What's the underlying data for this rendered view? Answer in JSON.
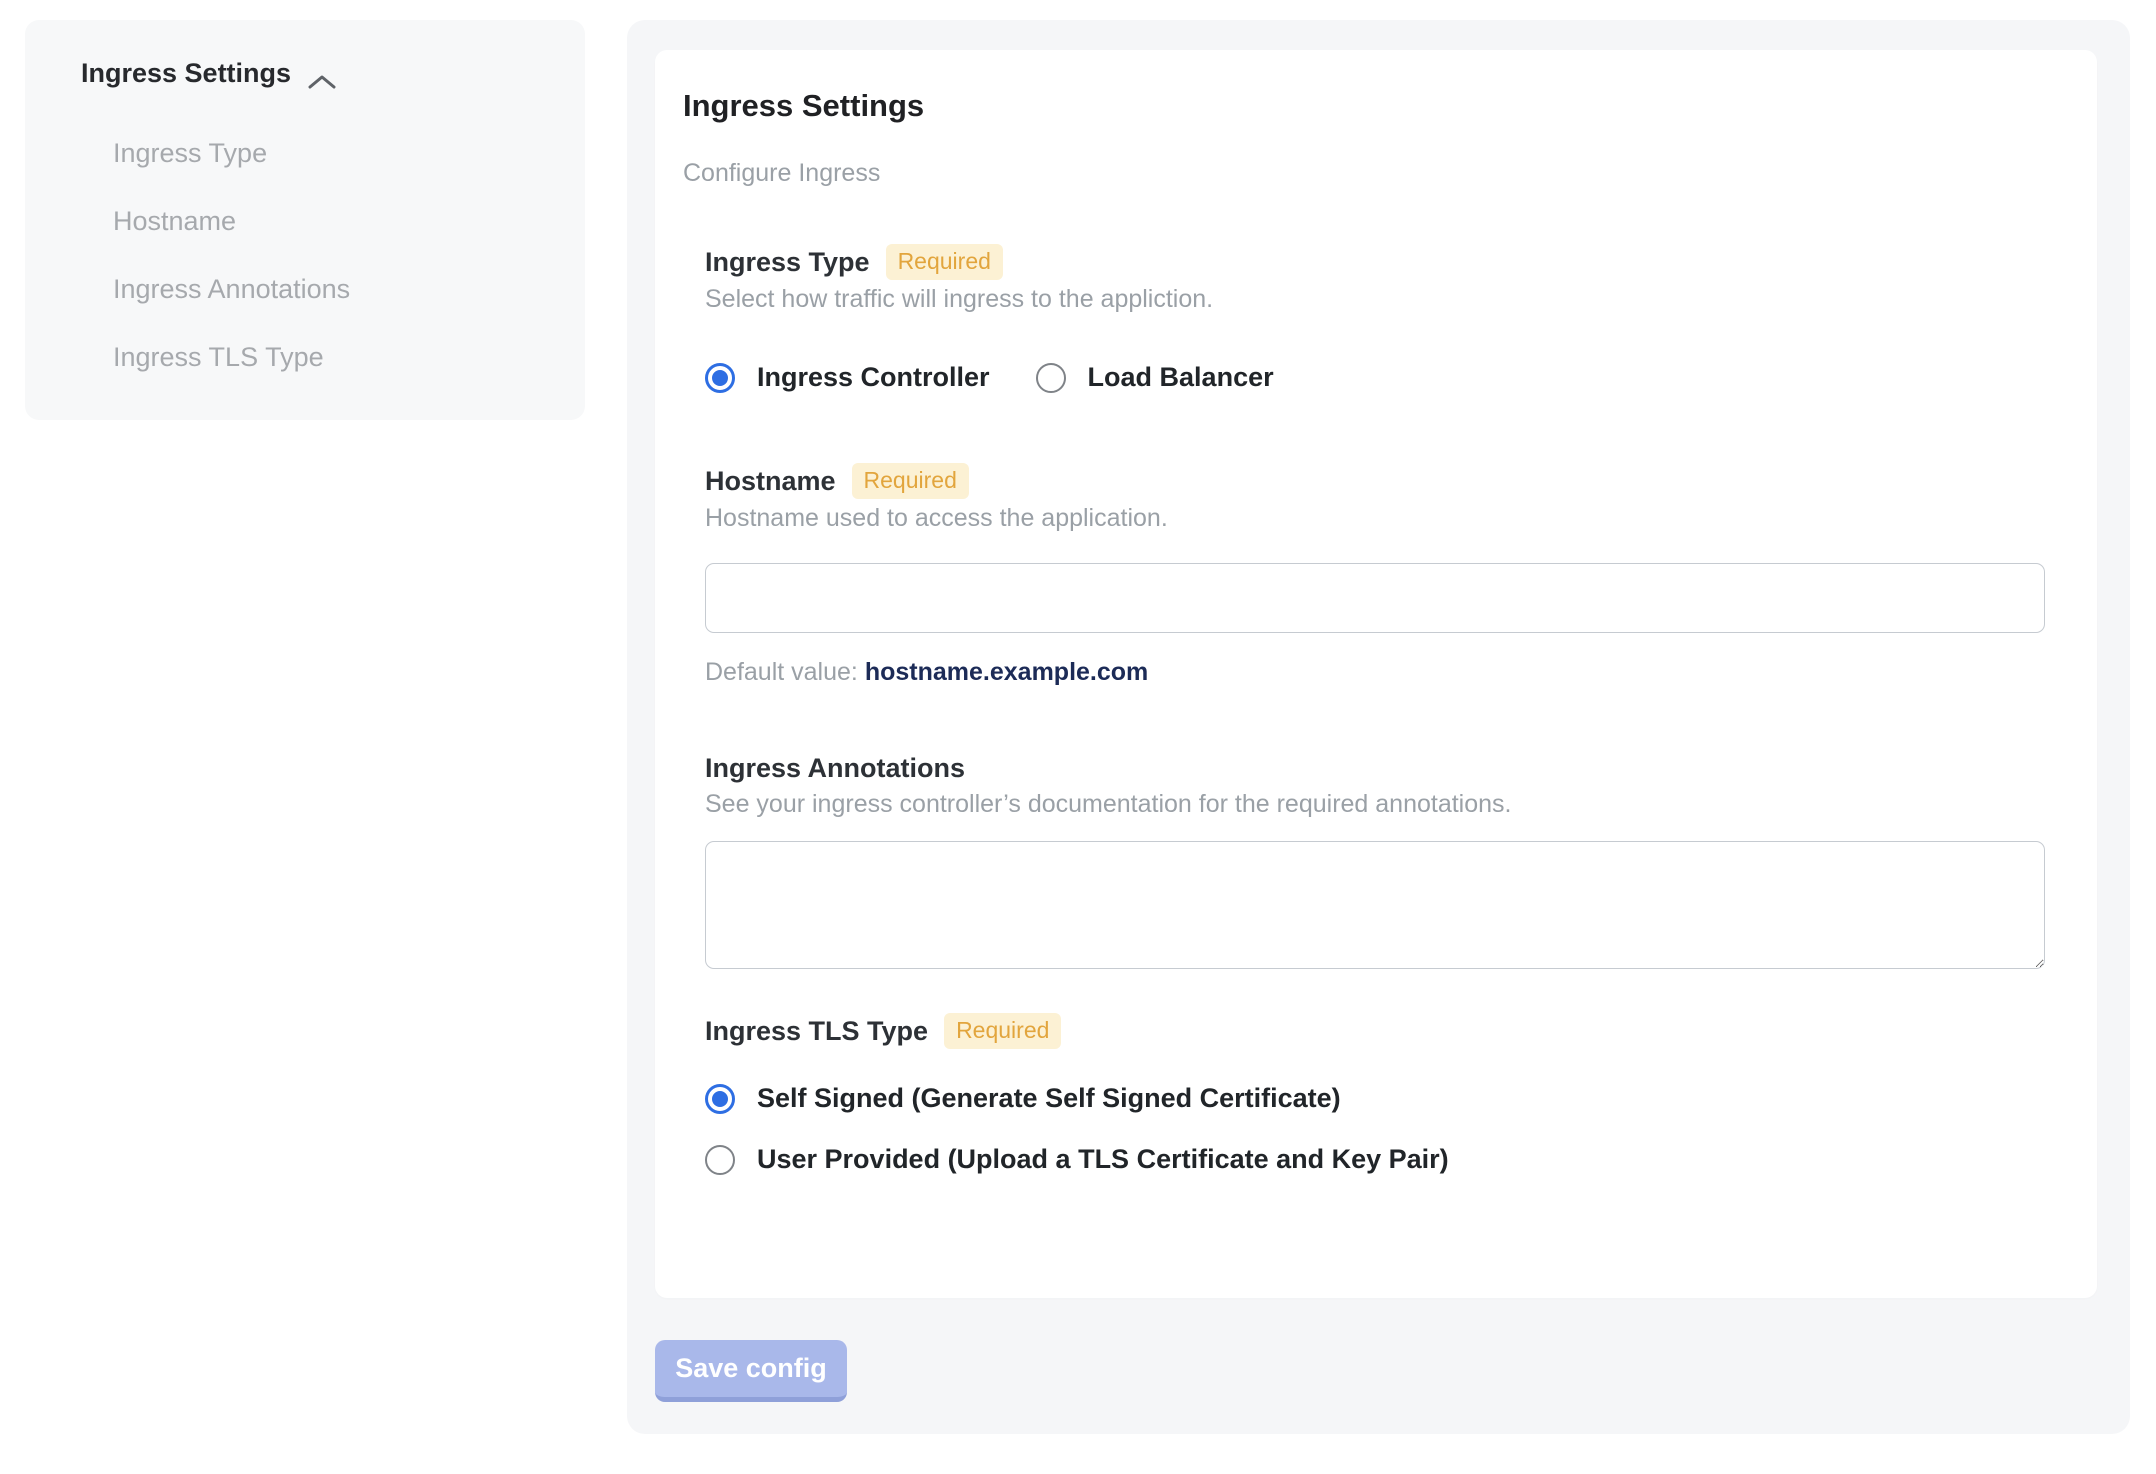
{
  "colors": {
    "accent_blue": "#2e6ee3",
    "badge_bg": "#fcf1d4",
    "badge_text": "#e2a53d",
    "save_button_bg": "#a9b8ea",
    "panel_bg": "#f5f6f8",
    "sidebar_bg": "#f7f8f9",
    "muted_text": "#9aa0a6",
    "default_value_text": "#1c2b57"
  },
  "sidebar": {
    "header": "Ingress Settings",
    "chevron_icon": "chevron-up",
    "items": [
      {
        "label": "Ingress Type"
      },
      {
        "label": "Hostname"
      },
      {
        "label": "Ingress Annotations"
      },
      {
        "label": "Ingress TLS Type"
      }
    ]
  },
  "panel": {
    "title": "Ingress Settings",
    "subtitle": "Configure Ingress",
    "fields": {
      "ingress_type": {
        "label": "Ingress Type",
        "required_badge": "Required",
        "help": "Select how traffic will ingress to the appliction.",
        "options": [
          {
            "label": "Ingress Controller",
            "selected": true
          },
          {
            "label": "Load Balancer",
            "selected": false
          }
        ]
      },
      "hostname": {
        "label": "Hostname",
        "required_badge": "Required",
        "help": "Hostname used to access the application.",
        "value": "",
        "default_prefix": "Default value: ",
        "default_value": "hostname.example.com"
      },
      "annotations": {
        "label": "Ingress Annotations",
        "help": "See your ingress controller’s documentation for the required annotations.",
        "value": ""
      },
      "tls": {
        "label": "Ingress TLS Type",
        "required_badge": "Required",
        "options": [
          {
            "label": "Self Signed (Generate Self Signed Certificate)",
            "selected": true
          },
          {
            "label": "User Provided (Upload a TLS Certificate and Key Pair)",
            "selected": false
          }
        ]
      }
    },
    "save_button": "Save config"
  }
}
